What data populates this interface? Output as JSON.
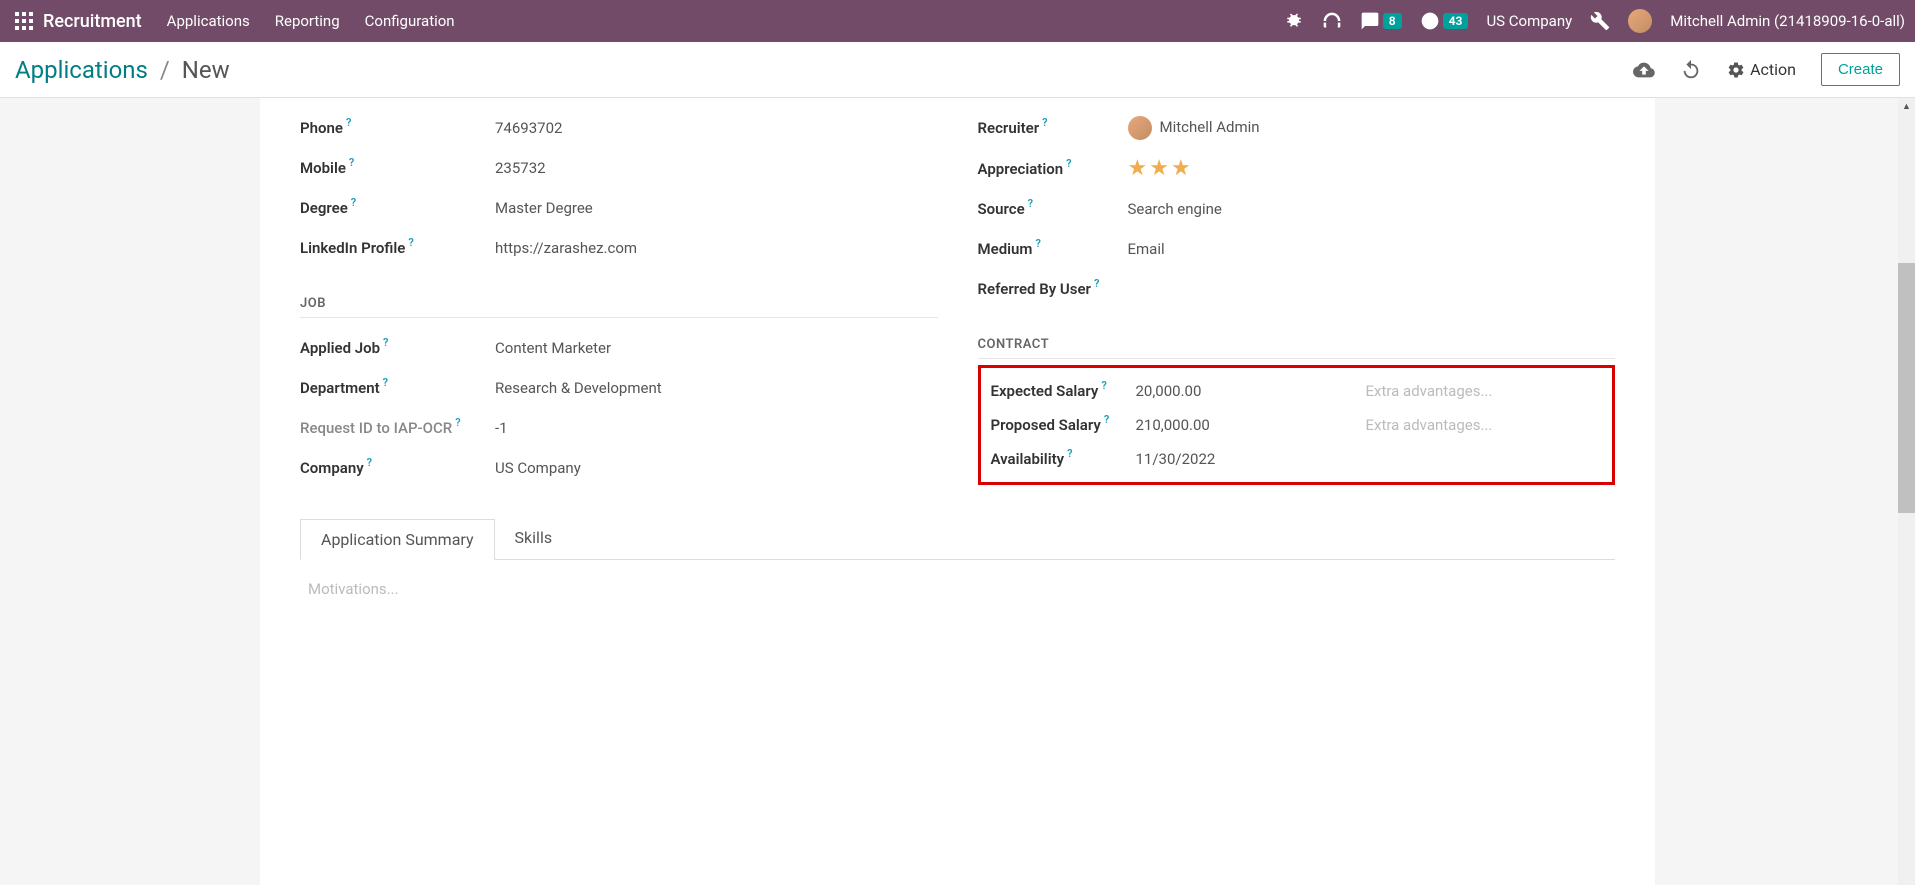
{
  "topbar": {
    "app_name": "Recruitment",
    "nav": [
      "Applications",
      "Reporting",
      "Configuration"
    ],
    "badges": {
      "chat": "8",
      "clock": "43"
    },
    "company": "US Company",
    "user": "Mitchell Admin (21418909-16-0-all)"
  },
  "breadcrumb": {
    "parent": "Applications",
    "current": "New"
  },
  "actions": {
    "action_label": "Action",
    "create_label": "Create"
  },
  "left_fields": {
    "phone": {
      "label": "Phone",
      "value": "74693702"
    },
    "mobile": {
      "label": "Mobile",
      "value": "235732"
    },
    "degree": {
      "label": "Degree",
      "value": "Master Degree"
    },
    "linkedin": {
      "label": "LinkedIn Profile",
      "value": "https://zarashez.com"
    }
  },
  "right_fields": {
    "recruiter": {
      "label": "Recruiter",
      "value": "Mitchell Admin"
    },
    "appreciation": {
      "label": "Appreciation",
      "stars": 3
    },
    "source": {
      "label": "Source",
      "value": "Search engine"
    },
    "medium": {
      "label": "Medium",
      "value": "Email"
    },
    "referred": {
      "label": "Referred By User",
      "value": ""
    }
  },
  "job_section": {
    "header": "JOB",
    "applied": {
      "label": "Applied Job",
      "value": "Content Marketer"
    },
    "department": {
      "label": "Department",
      "value": "Research & Development"
    },
    "request_id": {
      "label": "Request ID to IAP-OCR",
      "value": "-1"
    },
    "company": {
      "label": "Company",
      "value": "US Company"
    }
  },
  "contract_section": {
    "header": "CONTRACT",
    "expected_salary": {
      "label": "Expected Salary",
      "value": "20,000.00",
      "extra": "Extra advantages..."
    },
    "proposed_salary": {
      "label": "Proposed Salary",
      "value": "210,000.00",
      "extra": "Extra advantages..."
    },
    "availability": {
      "label": "Availability",
      "value": "11/30/2022"
    }
  },
  "tabs": {
    "summary": "Application Summary",
    "skills": "Skills"
  },
  "motivations_placeholder": "Motivations..."
}
